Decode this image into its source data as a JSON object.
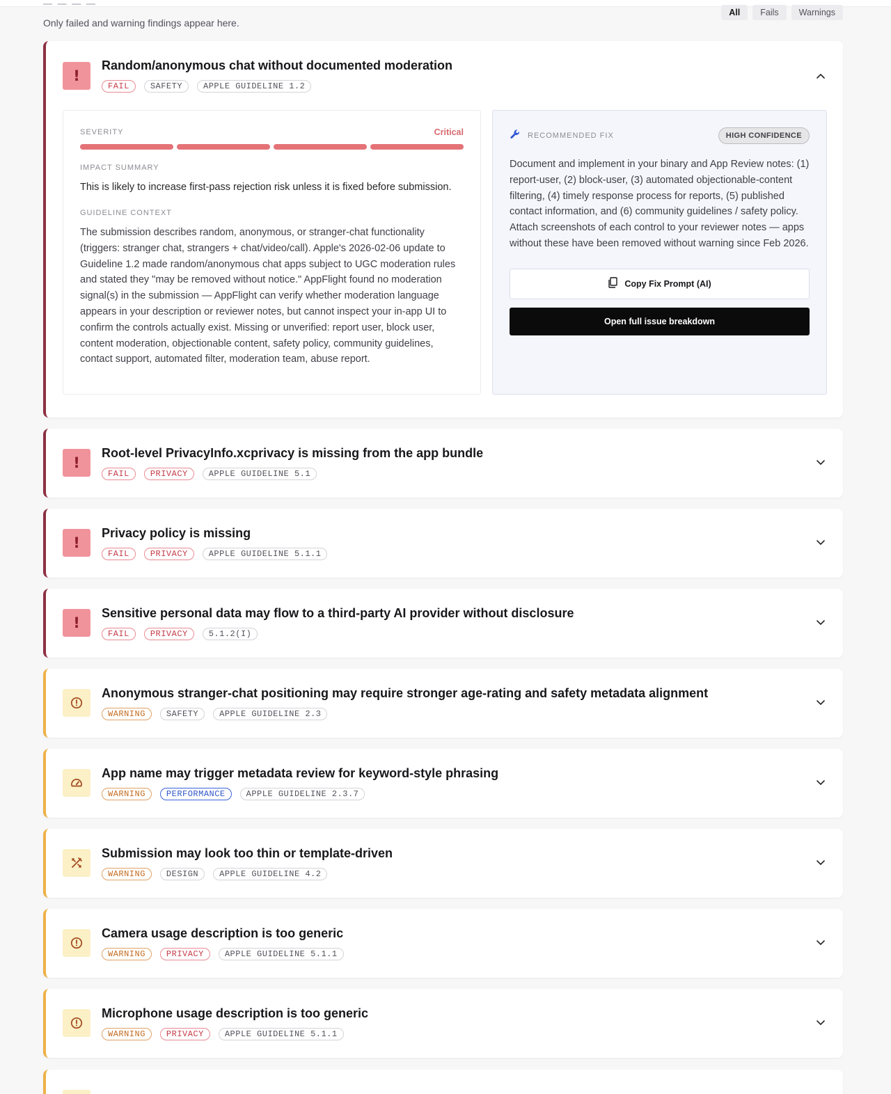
{
  "header": {
    "subtitle": "Only failed and warning findings appear here.",
    "filters": [
      {
        "label": "All",
        "active": true
      },
      {
        "label": "Fails",
        "active": false
      },
      {
        "label": "Warnings",
        "active": false
      }
    ]
  },
  "expanded": {
    "title": "Random/anonymous chat without documented moderation",
    "tags": [
      "FAIL",
      "SAFETY",
      "APPLE GUIDELINE 1.2"
    ],
    "severity_label": "SEVERITY",
    "severity_value": "Critical",
    "severity_level_of_4": 4,
    "impact_label": "IMPACT SUMMARY",
    "impact_text": "This is likely to increase first-pass rejection risk unless it is fixed before submission.",
    "context_label": "GUIDELINE CONTEXT",
    "context_text": "The submission describes random, anonymous, or stranger-chat functionality (triggers: stranger chat, strangers + chat/video/call). Apple's 2026-02-06 update to Guideline 1.2 made random/anonymous chat apps subject to UGC moderation rules and stated they \"may be removed without notice.\" AppFlight found no moderation signal(s) in the submission — AppFlight can verify whether moderation language appears in your description or reviewer notes, but cannot inspect your in-app UI to confirm the controls actually exist. Missing or unverified: report user, block user, content moderation, objectionable content, safety policy, community guidelines, contact support, automated filter, moderation team, abuse report.",
    "fix_label": "RECOMMENDED FIX",
    "confidence": "HIGH CONFIDENCE",
    "fix_text": "Document and implement in your binary and App Review notes: (1) report-user, (2) block-user, (3) automated objectionable-content filtering, (4) timely response process for reports, (5) published contact information, and (6) community guidelines / safety policy. Attach screenshots of each control to your reviewer notes — apps without these have been removed without warning since Feb 2026.",
    "copy_button": "Copy Fix Prompt (AI)",
    "open_button": "Open full issue breakdown"
  },
  "collapsed": [
    {
      "title": "Root-level PrivacyInfo.xcprivacy is missing from the app bundle",
      "tags": [
        "FAIL",
        "PRIVACY",
        "APPLE GUIDELINE 5.1"
      ],
      "icon": "exclamation-icon"
    },
    {
      "title": "Privacy policy is missing",
      "tags": [
        "FAIL",
        "PRIVACY",
        "APPLE GUIDELINE 5.1.1"
      ],
      "icon": "exclamation-icon"
    },
    {
      "title": "Sensitive personal data may flow to a third-party AI provider without disclosure",
      "tags": [
        "FAIL",
        "PRIVACY",
        "5.1.2(I)"
      ],
      "icon": "exclamation-icon"
    },
    {
      "title": "Anonymous stranger-chat positioning may require stronger age-rating and safety metadata alignment",
      "tags": [
        "WARNING",
        "SAFETY",
        "APPLE GUIDELINE 2.3"
      ],
      "icon": "alert-circle-icon"
    },
    {
      "title": "App name may trigger metadata review for keyword-style phrasing",
      "tags": [
        "WARNING",
        "PERFORMANCE",
        "APPLE GUIDELINE 2.3.7"
      ],
      "icon": "gauge-icon"
    },
    {
      "title": "Submission may look too thin or template-driven",
      "tags": [
        "WARNING",
        "DESIGN",
        "APPLE GUIDELINE 4.2"
      ],
      "icon": "design-tools-icon"
    },
    {
      "title": "Camera usage description is too generic",
      "tags": [
        "WARNING",
        "PRIVACY",
        "APPLE GUIDELINE 5.1.1"
      ],
      "icon": "alert-circle-icon"
    },
    {
      "title": "Microphone usage description is too generic",
      "tags": [
        "WARNING",
        "PRIVACY",
        "APPLE GUIDELINE 5.1.1"
      ],
      "icon": "alert-circle-icon"
    }
  ],
  "colors": {
    "fail_accent": "#8d3142",
    "warning_accent": "#eeb148",
    "critical": "#e47378",
    "performance": "#3a62d8"
  }
}
